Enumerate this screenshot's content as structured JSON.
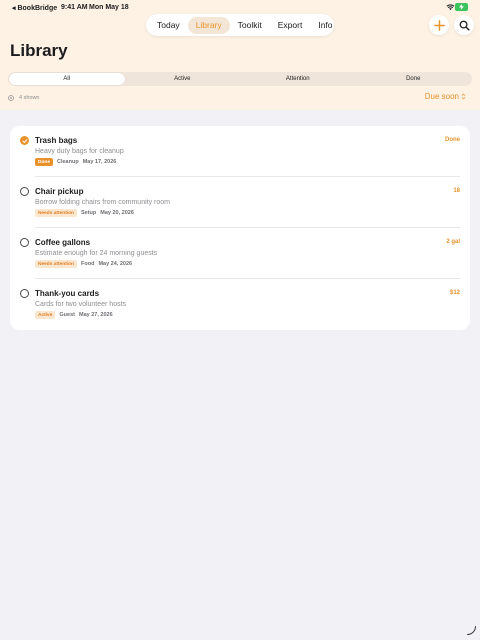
{
  "status_bar": {
    "back_label": "◂ BookBridge",
    "time": "9:41 AM",
    "date": "Mon May 18"
  },
  "nav": {
    "tabs": [
      {
        "label": "Today"
      },
      {
        "label": "Library"
      },
      {
        "label": "Toolkit"
      },
      {
        "label": "Export"
      },
      {
        "label": "Info"
      }
    ],
    "active_tab": "Library"
  },
  "page_title": "Library",
  "filters": {
    "tabs": [
      "All",
      "Active",
      "Attention",
      "Done"
    ],
    "selected": "All"
  },
  "summary": {
    "shown_label": "4 shown",
    "sort_label": "Due soon"
  },
  "items": [
    {
      "title": "Trash bags",
      "subtitle": "Heavy duty bags for cleanup",
      "status": "Done",
      "category": "Cleanup",
      "date": "May 17, 2026",
      "trailing": "Done",
      "checked": true
    },
    {
      "title": "Chair pickup",
      "subtitle": "Borrow folding chairs from community room",
      "status": "Needs attention",
      "category": "Setup",
      "date": "May 20, 2026",
      "trailing": "18",
      "checked": false
    },
    {
      "title": "Coffee gallons",
      "subtitle": "Estimate enough for 24 morning guests",
      "status": "Needs attention",
      "category": "Food",
      "date": "May 24, 2026",
      "trailing": "2 gal",
      "checked": false
    },
    {
      "title": "Thank-you cards",
      "subtitle": "Cards for two volunteer hosts",
      "status": "Active",
      "category": "Guest",
      "date": "May 27, 2026",
      "trailing": "$12",
      "checked": false
    }
  ],
  "colors": {
    "accent": "#e8922b",
    "header_bg": "#fdf2e4",
    "page_bg": "#f2f1f6"
  },
  "icons": {
    "add": "plus-icon",
    "search": "search-icon",
    "wifi": "wifi-icon",
    "battery": "battery-icon",
    "count": "circle-dot-icon",
    "sort": "chevron-up-down-icon",
    "check": "checkmark-icon"
  }
}
